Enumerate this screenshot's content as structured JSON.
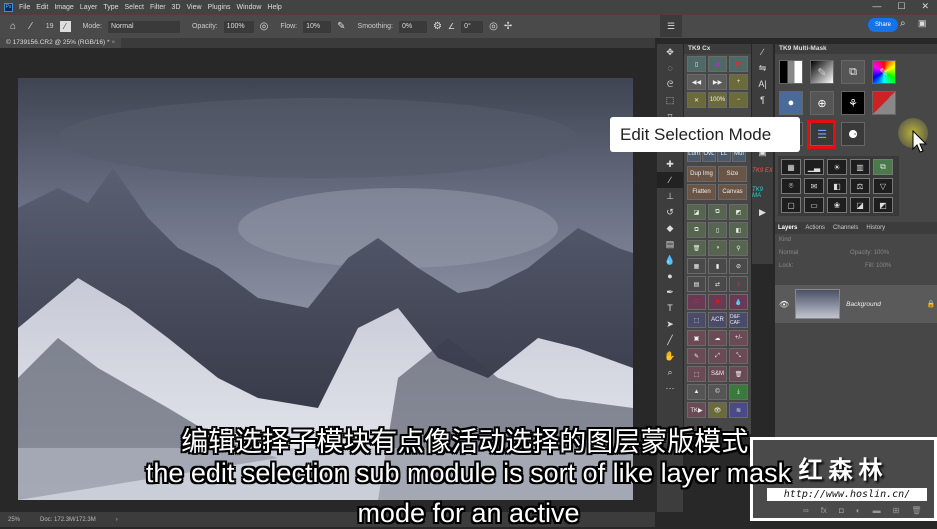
{
  "menubar": {
    "logo": "Ps",
    "items": [
      "File",
      "Edit",
      "Image",
      "Layer",
      "Type",
      "Select",
      "Filter",
      "3D",
      "View",
      "Plugins",
      "Window",
      "Help"
    ]
  },
  "window_controls": [
    "—",
    "☐",
    "✕"
  ],
  "options": {
    "brush_size": "19",
    "mode_label": "Mode:",
    "mode_value": "Normal",
    "opacity_label": "Opacity:",
    "opacity_value": "100%",
    "flow_label": "Flow:",
    "flow_value": "10%",
    "smoothing_label": "Smoothing:",
    "smoothing_value": "0%",
    "angle_value": "0°",
    "share_label": "Share"
  },
  "document": {
    "tab_title": "© 1739156.CR2 @ 25% (RGB/16) *",
    "close": "×"
  },
  "status": {
    "zoom": "25%",
    "doc": "Doc: 172.3M/172.3M",
    "arrow": "›"
  },
  "cx_panel": {
    "title": "TK9 Cx",
    "pct": "100%",
    "labels_row": [
      "Lum",
      "OvL",
      "LL",
      "Mul"
    ],
    "dup": "Dup Img",
    "size": "Size",
    "flatten": "Flatten",
    "canvas": "Canvas",
    "acr": "ACR",
    "dfcaf": "D&F CAF",
    "plusminus": "+/-",
    "sm": "S&M",
    "tk": "TK▶"
  },
  "strip": {
    "ex": "TK9 EX",
    "ma": "TK9 MA"
  },
  "multimask": {
    "title": "TK9 Multi-Mask"
  },
  "tooltip": "Edit Selection Mode",
  "layers": {
    "tabs": [
      "Layers",
      "Actions",
      "Channels",
      "History"
    ],
    "kind": "Kind",
    "blend": "Normal",
    "opacity_label": "Opacity:",
    "opacity": "100%",
    "lock_label": "Lock:",
    "fill_label": "Fill:",
    "fill": "100%",
    "layer_name": "Background"
  },
  "subtitles": {
    "zh": "编辑选择子模块有点像活动选择的图层蒙版模式,",
    "en1": "the edit selection sub module is sort of like layer mask",
    "en2": "mode for an active"
  },
  "watermark": {
    "title": "红森林",
    "url": "http://www.hoslin.cn/"
  }
}
